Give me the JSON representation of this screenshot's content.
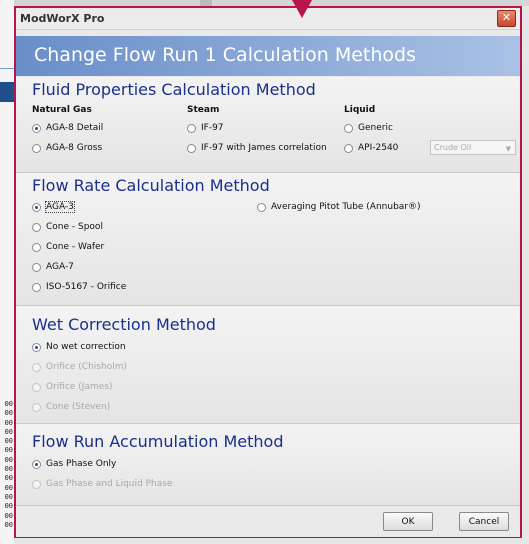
{
  "dialog": {
    "title": "ModWorX Pro",
    "header": "Change Flow Run 1 Calculation Methods"
  },
  "fluid": {
    "title": "Fluid Properties Calculation Method",
    "natural_gas": {
      "heading": "Natural Gas",
      "options": [
        "AGA-8 Detail",
        "AGA-8 Gross"
      ],
      "selected": "AGA-8 Detail"
    },
    "steam": {
      "heading": "Steam",
      "options": [
        "IF-97",
        "IF-97 with James correlation"
      ]
    },
    "liquid": {
      "heading": "Liquid",
      "options": [
        "Generic",
        "API-2540"
      ],
      "combo_value": "Crude Oil"
    }
  },
  "flow_rate": {
    "title": "Flow Rate Calculation Method",
    "options": [
      "AGA-3",
      "Cone - Spool",
      "Cone - Wafer",
      "AGA-7",
      "ISO-5167 - Orifice",
      "Averaging Pitot Tube (Annubar®)"
    ],
    "selected": "AGA-3"
  },
  "wet": {
    "title": "Wet Correction Method",
    "options": [
      "No wet correction",
      "Orifice (Chisholm)",
      "Orifice (James)",
      "Cone (Steven)"
    ],
    "selected": "No wet correction"
  },
  "accumulation": {
    "title": "Flow Run Accumulation Method",
    "options": [
      "Gas Phase Only",
      "Gas Phase and Liquid Phase"
    ],
    "selected": "Gas Phase Only"
  },
  "buttons": {
    "ok": "OK",
    "cancel": "Cancel"
  },
  "colors": {
    "accent_border": "#b8154a",
    "section_title": "#1a2f8a",
    "header_band": "#6a8ec9"
  },
  "background": {
    "numbers": [
      "00",
      "00",
      "00",
      "00",
      "00",
      "00",
      "00",
      "00",
      "00",
      "00",
      "00",
      "00",
      "00",
      "00"
    ]
  }
}
